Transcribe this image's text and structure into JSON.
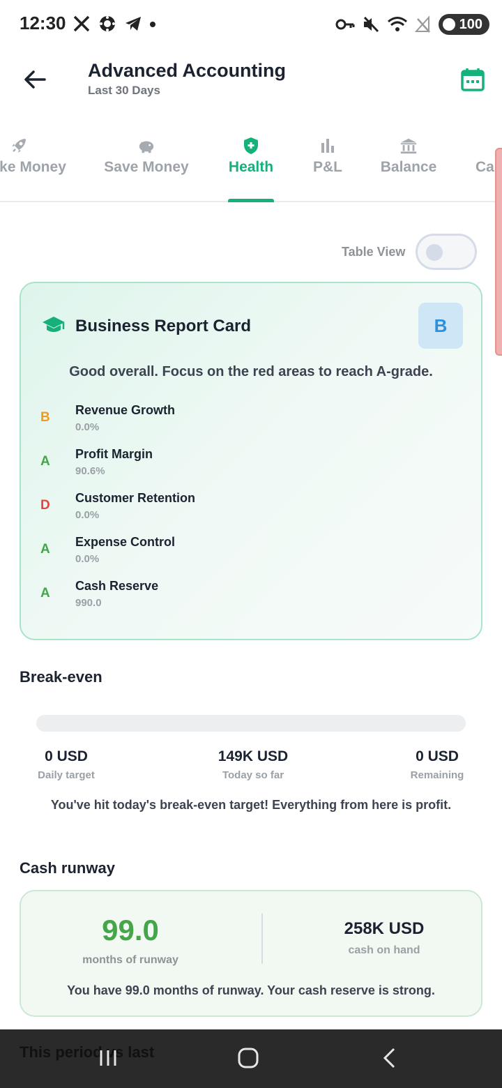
{
  "status_bar": {
    "time": "12:30",
    "battery": "100",
    "left_icons": [
      "x-logo-icon",
      "chip-icon",
      "telegram-icon",
      "dot-icon"
    ],
    "right_icons": [
      "key-icon",
      "mute-icon",
      "wifi-icon",
      "no-signal-icon"
    ]
  },
  "app_bar": {
    "title": "Advanced Accounting",
    "subtitle": "Last 30 Days"
  },
  "tabs": [
    {
      "label": "Make Money",
      "icon": "rocket-icon"
    },
    {
      "label": "Save Money",
      "icon": "piggy-bank-icon"
    },
    {
      "label": "Health",
      "icon": "shield-plus-icon",
      "active": true
    },
    {
      "label": "P&L",
      "icon": "bar-chart-icon"
    },
    {
      "label": "Balance",
      "icon": "bank-icon"
    },
    {
      "label": "Cash",
      "icon": "cash-icon"
    }
  ],
  "table_view": {
    "label": "Table View",
    "enabled": false
  },
  "report_card": {
    "title": "Business Report Card",
    "overall_grade": "B",
    "summary": "Good overall. Focus on the red areas to reach A-grade.",
    "metrics": [
      {
        "grade": "B",
        "name": "Revenue Growth",
        "value": "0.0%",
        "color": "#f29a1f"
      },
      {
        "grade": "A",
        "name": "Profit Margin",
        "value": "90.6%",
        "color": "#43a648"
      },
      {
        "grade": "D",
        "name": "Customer Retention",
        "value": "0.0%",
        "color": "#e5443a"
      },
      {
        "grade": "A",
        "name": "Expense Control",
        "value": "0.0%",
        "color": "#43a648"
      },
      {
        "grade": "A",
        "name": "Cash Reserve",
        "value": "990.0",
        "color": "#43a648"
      }
    ]
  },
  "break_even": {
    "title": "Break-even",
    "progress": 0,
    "daily_target_value": "0 USD",
    "daily_target_label": "Daily target",
    "today_value": "149K USD",
    "today_label": "Today so far",
    "remaining_value": "0 USD",
    "remaining_label": "Remaining",
    "message": "You've hit today's break-even target! Everything from here is profit."
  },
  "cash_runway": {
    "title": "Cash runway",
    "months": "99.0",
    "months_label": "months of runway",
    "cash": "258K USD",
    "cash_label": "cash on hand",
    "message": "You have 99.0 months of runway. Your cash reserve is strong."
  },
  "peek_section": {
    "title": "This period vs last"
  },
  "colors": {
    "accent": "#16b17a",
    "grade_b_bg": "#cfe6f6",
    "grade_b_text": "#2a91e0"
  }
}
